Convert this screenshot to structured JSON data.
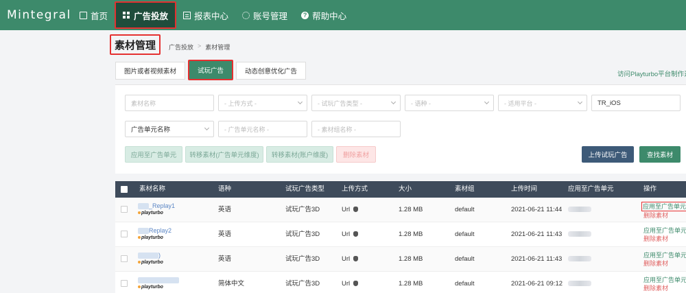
{
  "nav": {
    "logo": "Mintegral",
    "items": [
      {
        "label": "首页",
        "icon": "home-icon"
      },
      {
        "label": "广告投放",
        "icon": "grid-icon",
        "active": true
      },
      {
        "label": "报表中心",
        "icon": "report-icon"
      },
      {
        "label": "账号管理",
        "icon": "gear-icon"
      },
      {
        "label": "帮助中心",
        "icon": "help-icon"
      }
    ],
    "help_glyph": "?"
  },
  "page": {
    "title": "素材管理",
    "breadcrumb": [
      "广告投放",
      "素材管理"
    ],
    "breadcrumb_sep": ">"
  },
  "tabs": [
    {
      "label": "图片或者视频素材"
    },
    {
      "label": "试玩广告",
      "active": true
    },
    {
      "label": "动态创意优化广告"
    }
  ],
  "playturbo_link": "访问Playturbo平台制作素材",
  "filters": {
    "material_name_placeholder": "素材名称",
    "upload_method_placeholder": "- 上传方式 -",
    "playable_type_placeholder": "- 试玩广告类型 -",
    "language_placeholder": "- 语种 -",
    "platform_placeholder": "- 适用平台 -",
    "search_value": "TR_iOS",
    "unit_name_select": "广告单元名称",
    "unit_name_placeholder": "- 广告单元名称 -",
    "material_group_placeholder": "- 素材组名称 -"
  },
  "actions": {
    "apply_to_unit": "应用至广告单元",
    "move_by_unit": "转移素材(广告单元维度)",
    "move_by_account": "转移素材(账户维度)",
    "delete": "删除素材",
    "upload_playable": "上传试玩广告",
    "find_material": "查找素材"
  },
  "table": {
    "columns": [
      "素材名称",
      "语种",
      "试玩广告类型",
      "上传方式",
      "大小",
      "素材组",
      "上传时间",
      "应用至广告单元",
      "操作"
    ],
    "brand_text": "playturbo",
    "rows": [
      {
        "name": "_Replay1",
        "language": "英语",
        "type": "试玩广告3D",
        "upload": "Url",
        "size": "1.28 MB",
        "group": "default",
        "time": "2021-06-21 11:44",
        "op_apply": "应用至广告单元",
        "op_delete": "删除素材"
      },
      {
        "name": "Replay2",
        "language": "英语",
        "type": "试玩广告3D",
        "upload": "Url",
        "size": "1.28 MB",
        "group": "default",
        "time": "2021-06-21 11:43",
        "op_apply": "应用至广告单元",
        "op_delete": "删除素材"
      },
      {
        "name": ")",
        "language": "英语",
        "type": "试玩广告3D",
        "upload": "Url",
        "size": "1.28 MB",
        "group": "default",
        "time": "2021-06-21 11:43",
        "op_apply": "应用至广告单元",
        "op_delete": "删除素材"
      },
      {
        "name": "",
        "language": "简体中文",
        "type": "试玩广告3D",
        "upload": "Url",
        "size": "1.28 MB",
        "group": "default",
        "time": "2021-06-21 09:12",
        "op_apply": "应用至广告单元",
        "op_delete": "删除素材"
      }
    ]
  },
  "colors": {
    "primary": "#3d8a6b",
    "nav_active": "#1f4d3c",
    "table_header": "#3e4b5b",
    "highlight_border": "#e53030",
    "danger": "#e06060"
  }
}
